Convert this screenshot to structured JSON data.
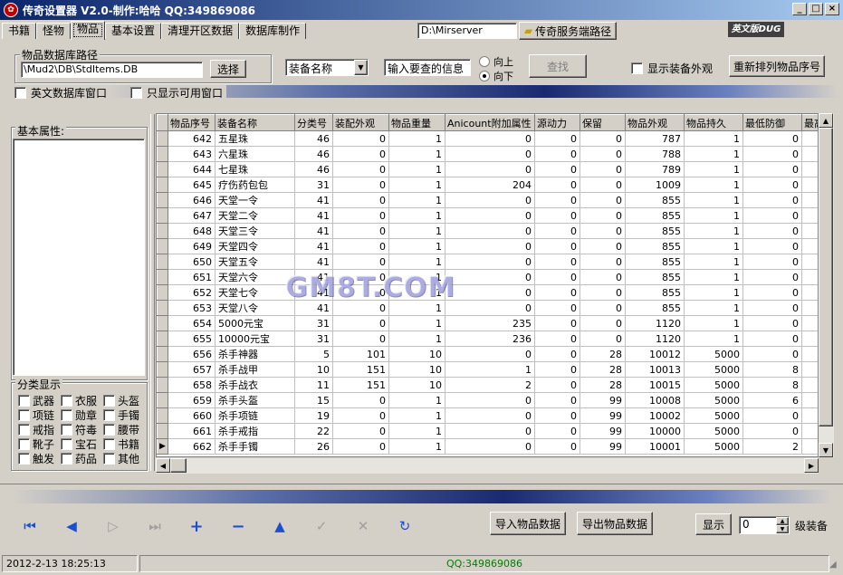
{
  "window": {
    "title": "传奇设置器 V2.0-制作:哈哈 QQ:349869086"
  },
  "tabs": [
    {
      "label": "书籍"
    },
    {
      "label": "怪物"
    },
    {
      "label": "物品"
    },
    {
      "label": "基本设置"
    },
    {
      "label": "清理开区数据"
    },
    {
      "label": "数据库制作"
    }
  ],
  "server_path": {
    "value": "D:\\Mirserver",
    "button": "传奇服务端路径"
  },
  "logo_text": "英文版DUG",
  "db_path": {
    "group_label": "物品数据库路径",
    "value": "\\Mud2\\DB\\StdItems.DB",
    "button": "选择"
  },
  "search": {
    "field_select": "装备名称",
    "query_placeholder": "输入要查的信息",
    "dir_up": "向上",
    "dir_down": "向下",
    "find_button": "查找"
  },
  "options": {
    "show_equip_look": "显示装备外观",
    "reorder_button": "重新排列物品序号",
    "english_db_window": "英文数据库窗口",
    "only_available_window": "只显示可用窗口"
  },
  "left_panel": {
    "basic_attr_label": "基本属性:",
    "category_label": "分类显示",
    "categories": [
      [
        "武器",
        "衣服",
        "头盔"
      ],
      [
        "项链",
        "勋章",
        "手镯"
      ],
      [
        "戒指",
        "符毒",
        "腰带"
      ],
      [
        "靴子",
        "宝石",
        "书籍"
      ],
      [
        "触发",
        "药品",
        "其他"
      ]
    ]
  },
  "table": {
    "columns": [
      "物品序号",
      "装备名称",
      "分类号",
      "装配外观",
      "物品重量",
      "Anicount附加属性",
      "源动力",
      "保留",
      "物品外观",
      "物品持久",
      "最低防御",
      "最高"
    ],
    "rows": [
      [
        "642",
        "五星珠",
        "46",
        "0",
        "1",
        "0",
        "0",
        "0",
        "787",
        "1",
        "0"
      ],
      [
        "643",
        "六星珠",
        "46",
        "0",
        "1",
        "0",
        "0",
        "0",
        "788",
        "1",
        "0"
      ],
      [
        "644",
        "七星珠",
        "46",
        "0",
        "1",
        "0",
        "0",
        "0",
        "789",
        "1",
        "0"
      ],
      [
        "645",
        "疗伤药包包",
        "31",
        "0",
        "1",
        "204",
        "0",
        "0",
        "1009",
        "1",
        "0"
      ],
      [
        "646",
        "天堂一令",
        "41",
        "0",
        "1",
        "0",
        "0",
        "0",
        "855",
        "1",
        "0"
      ],
      [
        "647",
        "天堂二令",
        "41",
        "0",
        "1",
        "0",
        "0",
        "0",
        "855",
        "1",
        "0"
      ],
      [
        "648",
        "天堂三令",
        "41",
        "0",
        "1",
        "0",
        "0",
        "0",
        "855",
        "1",
        "0"
      ],
      [
        "649",
        "天堂四令",
        "41",
        "0",
        "1",
        "0",
        "0",
        "0",
        "855",
        "1",
        "0"
      ],
      [
        "650",
        "天堂五令",
        "41",
        "0",
        "1",
        "0",
        "0",
        "0",
        "855",
        "1",
        "0"
      ],
      [
        "651",
        "天堂六令",
        "41",
        "0",
        "1",
        "0",
        "0",
        "0",
        "855",
        "1",
        "0"
      ],
      [
        "652",
        "天堂七令",
        "41",
        "0",
        "1",
        "0",
        "0",
        "0",
        "855",
        "1",
        "0"
      ],
      [
        "653",
        "天堂八令",
        "41",
        "0",
        "1",
        "0",
        "0",
        "0",
        "855",
        "1",
        "0"
      ],
      [
        "654",
        "5000元宝",
        "31",
        "0",
        "1",
        "235",
        "0",
        "0",
        "1120",
        "1",
        "0"
      ],
      [
        "655",
        "10000元宝",
        "31",
        "0",
        "1",
        "236",
        "0",
        "0",
        "1120",
        "1",
        "0"
      ],
      [
        "656",
        "杀手神器",
        "5",
        "101",
        "10",
        "0",
        "0",
        "28",
        "10012",
        "5000",
        "0"
      ],
      [
        "657",
        "杀手战甲",
        "10",
        "151",
        "10",
        "1",
        "0",
        "28",
        "10013",
        "5000",
        "8"
      ],
      [
        "658",
        "杀手战衣",
        "11",
        "151",
        "10",
        "2",
        "0",
        "28",
        "10015",
        "5000",
        "8"
      ],
      [
        "659",
        "杀手头盔",
        "15",
        "0",
        "1",
        "0",
        "0",
        "99",
        "10008",
        "5000",
        "6"
      ],
      [
        "660",
        "杀手项链",
        "19",
        "0",
        "1",
        "0",
        "0",
        "99",
        "10002",
        "5000",
        "0"
      ],
      [
        "661",
        "杀手戒指",
        "22",
        "0",
        "1",
        "0",
        "0",
        "99",
        "10000",
        "5000",
        "0"
      ],
      [
        "662",
        "杀手手镯",
        "26",
        "0",
        "1",
        "0",
        "0",
        "99",
        "10001",
        "5000",
        "2"
      ]
    ]
  },
  "watermark": "GM8T.COM",
  "bottom": {
    "import_button": "导入物品数据",
    "export_button": "导出物品数据",
    "show_button": "显示",
    "level_value": "0",
    "level_label": "级装备"
  },
  "status": {
    "datetime": "2012-2-13  18:25:13",
    "qq": "QQ:349869086"
  }
}
